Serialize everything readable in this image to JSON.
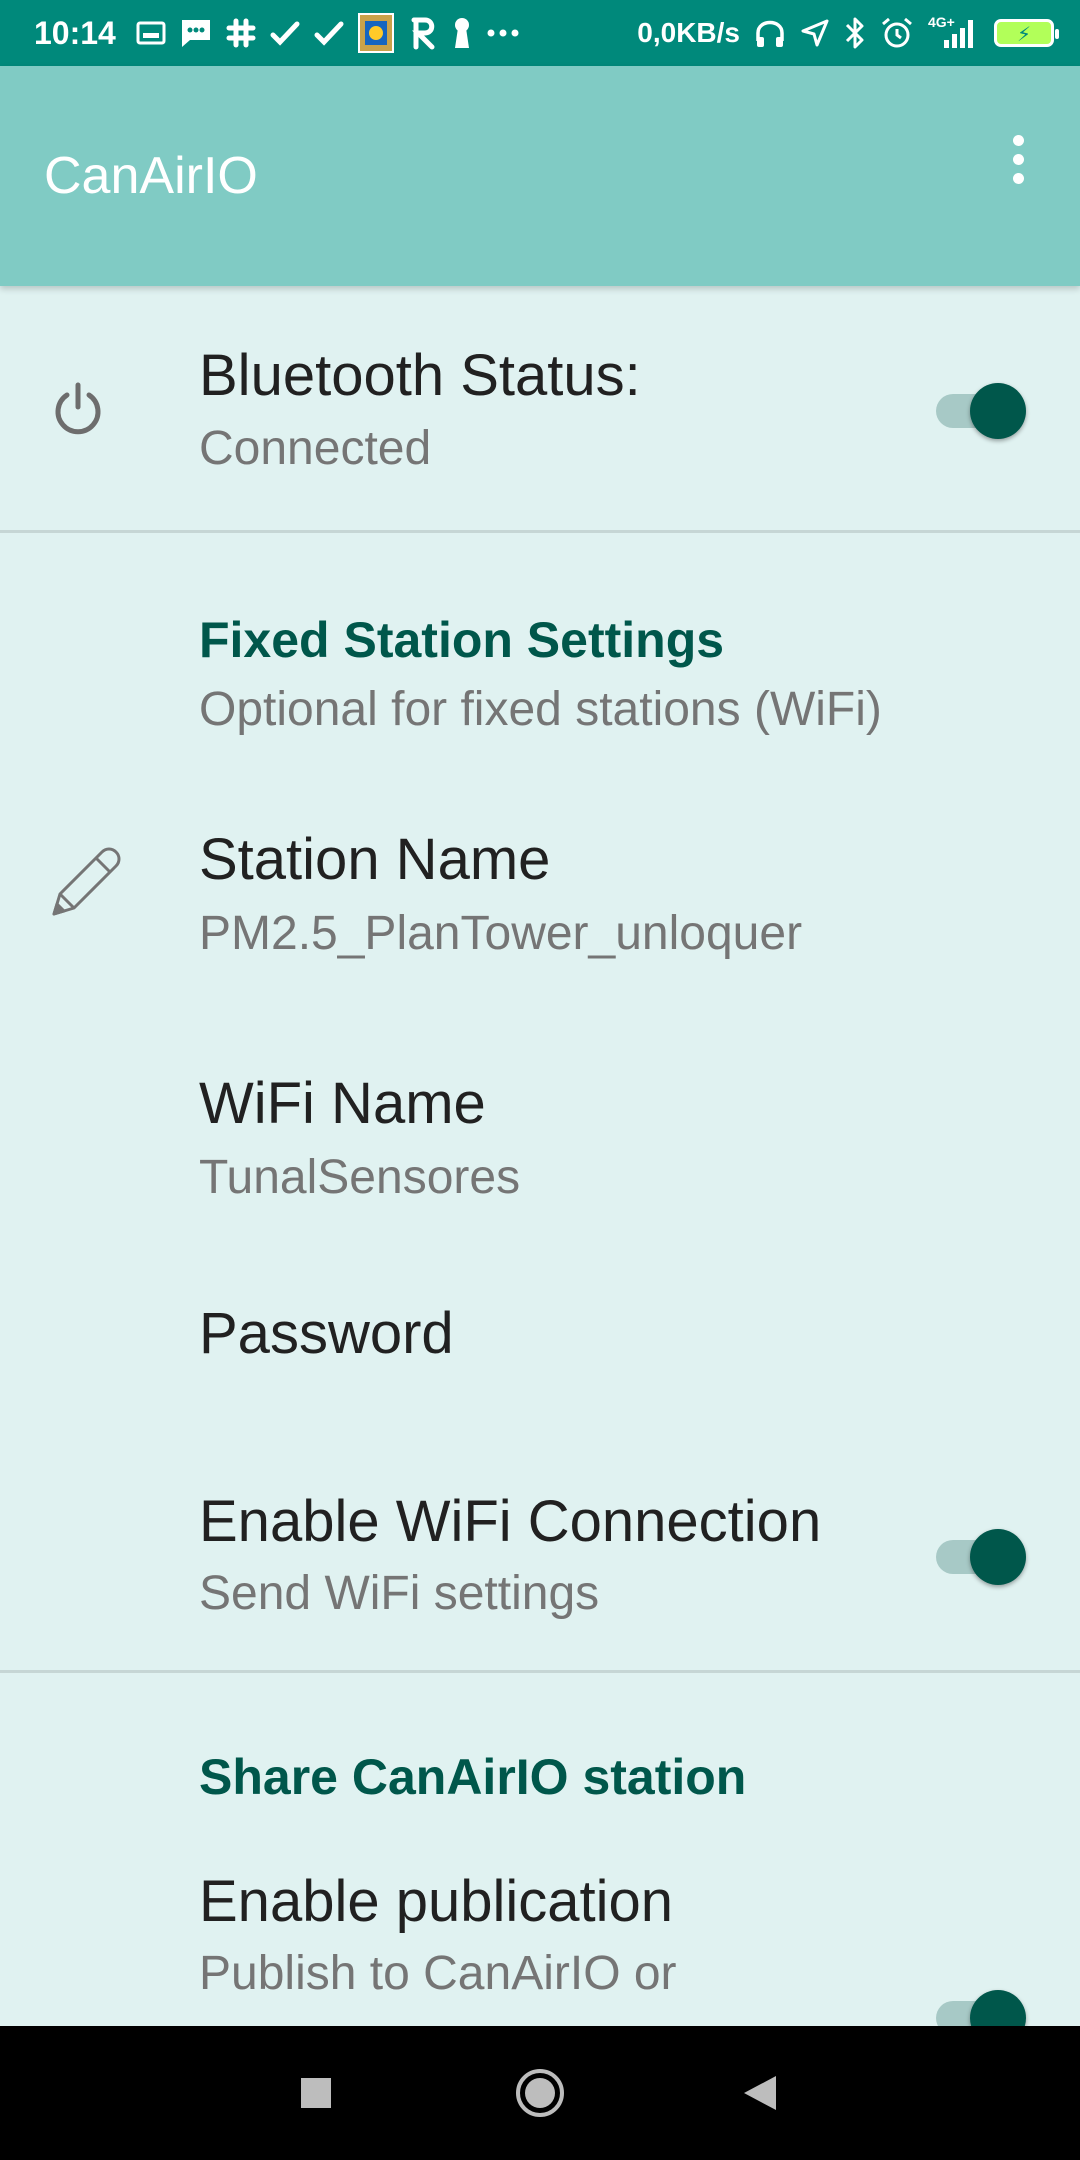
{
  "status_bar": {
    "time": "10:14",
    "network_speed": "0,0KB/s",
    "signal_label": "4G+",
    "left_icons": [
      "gallery-icon",
      "message-icon",
      "slack-icon",
      "check-icon",
      "check-icon",
      "app-logo-icon",
      "r-app-icon",
      "keyhole-icon",
      "more-dots-icon"
    ],
    "right_icons": [
      "headset-icon",
      "location-arrow-icon",
      "bluetooth-icon",
      "alarm-icon",
      "signal-icon",
      "battery-charging-icon"
    ],
    "background_color": "#00897b"
  },
  "app_bar": {
    "title": "CanAirIO",
    "overflow_icon": "more-vert-icon",
    "background_color": "#80cbc4"
  },
  "preferences": {
    "bluetooth": {
      "icon": "power-icon",
      "title": "Bluetooth Status:",
      "summary": "Connected",
      "enabled": true
    },
    "fixed_station_category": {
      "title": "Fixed Station Settings",
      "summary": "Optional for fixed stations (WiFi)"
    },
    "station_name": {
      "icon": "pencil-icon",
      "title": "Station Name",
      "summary": "PM2.5_PlanTower_unloquer"
    },
    "wifi_name": {
      "title": "WiFi Name",
      "summary": "TunalSensores"
    },
    "password": {
      "title": "Password"
    },
    "enable_wifi": {
      "title": "Enable WiFi Connection",
      "summary": "Send WiFi settings",
      "enabled": true
    },
    "share_category": {
      "title": "Share CanAirIO station"
    },
    "enable_publication": {
      "title": "Enable publication",
      "summary": "Publish to CanAirIO or",
      "enabled": true
    }
  },
  "accent_color": "#00574b",
  "nav_bar": {
    "buttons": [
      "recents-square-icon",
      "home-circle-icon",
      "back-triangle-icon"
    ]
  }
}
